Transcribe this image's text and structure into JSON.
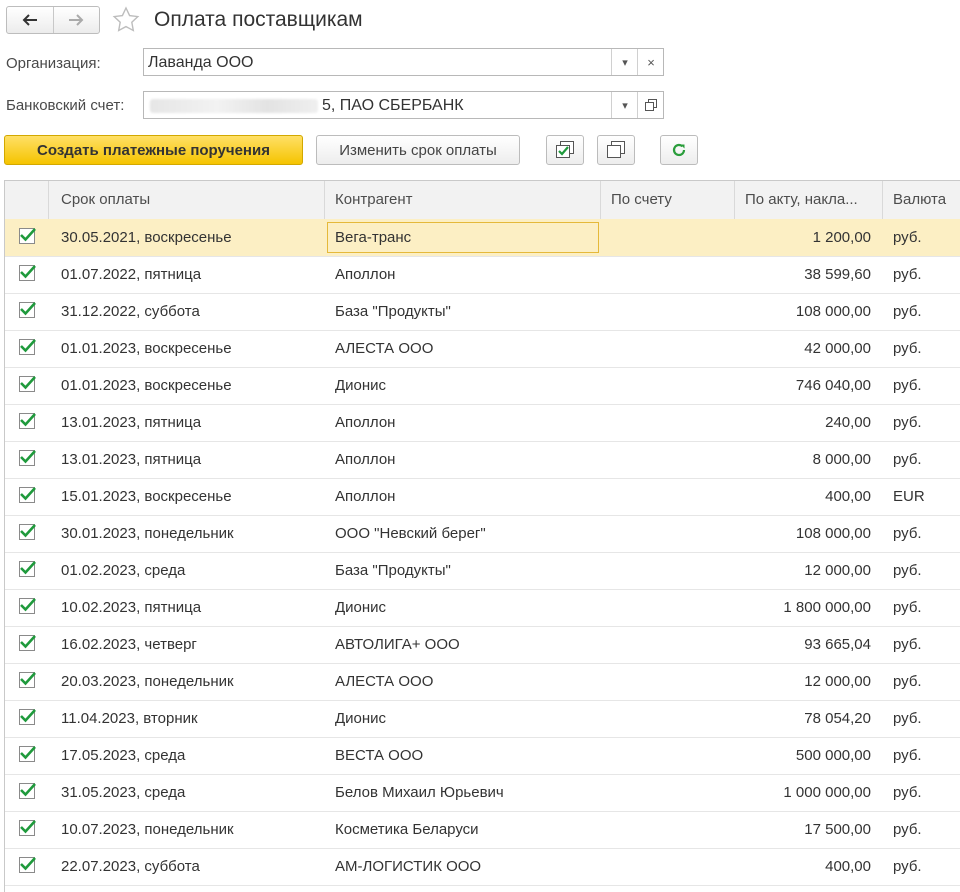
{
  "header": {
    "title": "Оплата поставщикам"
  },
  "form": {
    "org_label": "Организация:",
    "org_value": "Лаванда ООО",
    "account_label": "Банковский счет:",
    "account_value": "5, ПАО СБЕРБАНК"
  },
  "toolbar": {
    "create_label": "Создать платежные поручения",
    "change_date_label": "Изменить срок оплаты"
  },
  "table": {
    "columns": [
      "Срок оплаты",
      "Контрагент",
      "По счету",
      "По акту, накла...",
      "Валюта"
    ],
    "rows": [
      {
        "date": "30.05.2021, воскресенье",
        "partner": "Вега-транс",
        "by_invoice": "",
        "by_act": "1 200,00",
        "currency": "руб.",
        "checked": true,
        "selected": true
      },
      {
        "date": "01.07.2022, пятница",
        "partner": "Аполлон",
        "by_invoice": "",
        "by_act": "38 599,60",
        "currency": "руб.",
        "checked": true
      },
      {
        "date": "31.12.2022, суббота",
        "partner": "База \"Продукты\"",
        "by_invoice": "",
        "by_act": "108 000,00",
        "currency": "руб.",
        "checked": true
      },
      {
        "date": "01.01.2023, воскресенье",
        "partner": "АЛЕСТА ООО",
        "by_invoice": "",
        "by_act": "42 000,00",
        "currency": "руб.",
        "checked": true
      },
      {
        "date": "01.01.2023, воскресенье",
        "partner": "Дионис",
        "by_invoice": "",
        "by_act": "746 040,00",
        "currency": "руб.",
        "checked": true
      },
      {
        "date": "13.01.2023, пятница",
        "partner": "Аполлон",
        "by_invoice": "",
        "by_act": "240,00",
        "currency": "руб.",
        "checked": true
      },
      {
        "date": "13.01.2023, пятница",
        "partner": "Аполлон",
        "by_invoice": "",
        "by_act": "8 000,00",
        "currency": "руб.",
        "checked": true
      },
      {
        "date": "15.01.2023, воскресенье",
        "partner": "Аполлон",
        "by_invoice": "",
        "by_act": "400,00",
        "currency": "EUR",
        "checked": true
      },
      {
        "date": "30.01.2023, понедельник",
        "partner": "ООО \"Невский берег\"",
        "by_invoice": "",
        "by_act": "108 000,00",
        "currency": "руб.",
        "checked": true
      },
      {
        "date": "01.02.2023, среда",
        "partner": "База \"Продукты\"",
        "by_invoice": "",
        "by_act": "12 000,00",
        "currency": "руб.",
        "checked": true
      },
      {
        "date": "10.02.2023, пятница",
        "partner": "Дионис",
        "by_invoice": "",
        "by_act": "1 800 000,00",
        "currency": "руб.",
        "checked": true
      },
      {
        "date": "16.02.2023, четверг",
        "partner": "АВТОЛИГА+ ООО",
        "by_invoice": "",
        "by_act": "93 665,04",
        "currency": "руб.",
        "checked": true
      },
      {
        "date": "20.03.2023, понедельник",
        "partner": "АЛЕСТА ООО",
        "by_invoice": "",
        "by_act": "12 000,00",
        "currency": "руб.",
        "checked": true
      },
      {
        "date": "11.04.2023, вторник",
        "partner": "Дионис",
        "by_invoice": "",
        "by_act": "78 054,20",
        "currency": "руб.",
        "checked": true
      },
      {
        "date": "17.05.2023, среда",
        "partner": "ВЕСТА ООО",
        "by_invoice": "",
        "by_act": "500 000,00",
        "currency": "руб.",
        "checked": true
      },
      {
        "date": "31.05.2023, среда",
        "partner": "Белов Михаил Юрьевич",
        "by_invoice": "",
        "by_act": "1 000 000,00",
        "currency": "руб.",
        "checked": true
      },
      {
        "date": "10.07.2023, понедельник",
        "partner": "Косметика Беларуси",
        "by_invoice": "",
        "by_act": "17 500,00",
        "currency": "руб.",
        "checked": true
      },
      {
        "date": "22.07.2023, суббота",
        "partner": "АМ-ЛОГИСТИК ООО",
        "by_invoice": "",
        "by_act": "400,00",
        "currency": "руб.",
        "checked": true
      }
    ]
  },
  "colors": {
    "accent_yellow": "#f5c400",
    "check_green": "#1f9a3c",
    "refresh_green": "#2a9d3b",
    "selected_row": "#fcefc4"
  }
}
